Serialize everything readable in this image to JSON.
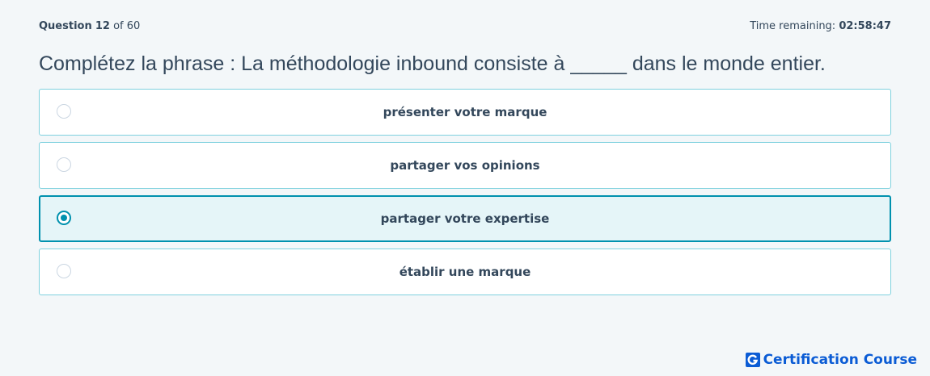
{
  "header": {
    "question_label": "Question",
    "question_number": "12",
    "question_of": "of 60",
    "time_label": "Time remaining:",
    "time_value": "02:58:47"
  },
  "question": {
    "text": "Complétez la phrase : La méthodologie inbound consiste à _____ dans le monde entier."
  },
  "options": [
    {
      "label": "présenter votre marque",
      "selected": false
    },
    {
      "label": "partager vos opinions",
      "selected": false
    },
    {
      "label": "partager votre expertise",
      "selected": true
    },
    {
      "label": "établir une marque",
      "selected": false
    }
  ],
  "brand": {
    "name": "Certification Course",
    "logo_letter": "G",
    "color": "#0b5cd5"
  },
  "colors": {
    "accent": "#0091ae",
    "option_border": "#7fd1de",
    "selected_bg": "#e5f5f8",
    "text": "#33475b",
    "page_bg": "#f3f7f9"
  }
}
